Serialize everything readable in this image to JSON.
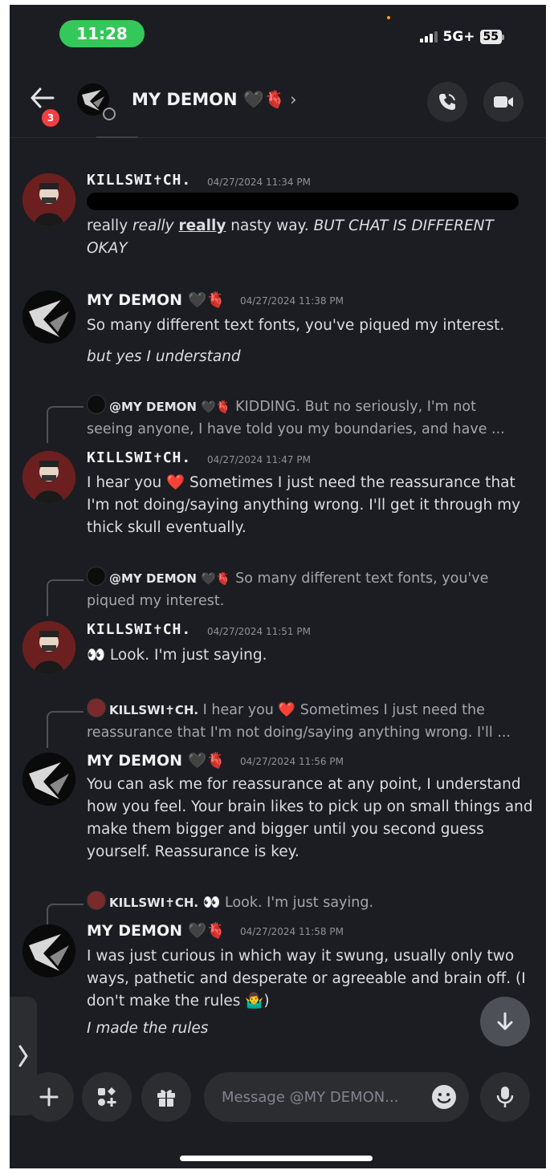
{
  "status_bar": {
    "time": "11:28",
    "network": "5G+",
    "battery": "55"
  },
  "header": {
    "badge": "3",
    "title": "MY DEMON 🖤🫀",
    "chevron": "›"
  },
  "messages": [
    {
      "author": "KILLSWI✝CH.",
      "timestamp": "04/27/2024 11:34 PM",
      "line1": "really",
      "line1_em": "really",
      "line1_bold": "really",
      "line1_rest": " nasty way. ",
      "line1_it": "BUT CHAT IS DIFFERENT",
      "line2_it": "OKAY"
    },
    {
      "author": "MY DEMON 🖤🫀",
      "timestamp": "04/27/2024 11:38 PM",
      "text": "So many different text fonts, you've piqued my interest.",
      "text2": "but yes I understand"
    },
    {
      "reply_author": "@MY DEMON 🖤🫀",
      "reply_text1": " KIDDING. But no seriously, I'm not",
      "reply_text2": "seeing anyone, I have told you my boundaries, and have ...",
      "author": "KILLSWI✝CH.",
      "timestamp": "04/27/2024 11:47 PM",
      "text1": "I hear you ❤️ Sometimes I just need the reassurance that",
      "text2": "I'm not doing/saying anything wrong. I'll get it through my",
      "text3": "thick skull eventually."
    },
    {
      "reply_author": "@MY DEMON 🖤🫀",
      "reply_text1": " So many different text fonts, you've",
      "reply_text2": "piqued my interest.",
      "author": "KILLSWI✝CH.",
      "timestamp": "04/27/2024 11:51 PM",
      "text": "👀 Look. I'm just saying."
    },
    {
      "reply_author": "KILLSWI✝CH.",
      "reply_text1": " I hear you ❤️ Sometimes I just need the",
      "reply_text2": "reassurance that I'm not doing/saying anything wrong. I'll ...",
      "author": "MY DEMON 🖤🫀",
      "timestamp": "04/27/2024 11:56 PM",
      "text1": "You can ask me for reassurance at any point, I understand",
      "text2": "how you feel. Your brain likes to pick up on small things and",
      "text3": "make them bigger and bigger until you second guess",
      "text4": "yourself. Reassurance is key."
    },
    {
      "reply_author": "KILLSWI✝CH.",
      "reply_text1": " 👀 Look. I'm just saying.",
      "author": "MY DEMON 🖤🫀",
      "timestamp": "04/27/2024 11:58 PM",
      "text1": "I was just curious in which way it swung, usually only two",
      "text2": "ways, pathetic and desperate or agreeable and brain off. (I",
      "text3": "don't make the rules 🤷‍♂️)",
      "text4": "I made the rules"
    }
  ],
  "composer": {
    "placeholder": "Message @MY DEMON..."
  },
  "icons": [
    "back-arrow-icon",
    "phone-icon",
    "video-icon",
    "plus-icon",
    "apps-icon",
    "gift-icon",
    "emoji-icon",
    "mic-icon",
    "arrow-down-icon",
    "chevron-right-icon"
  ]
}
